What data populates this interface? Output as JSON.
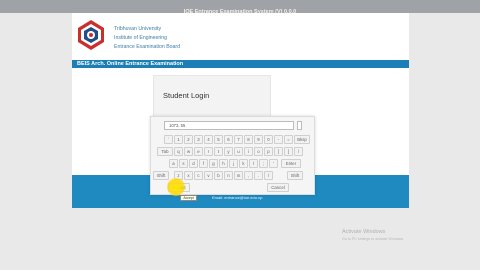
{
  "window": {
    "title": "IOE Entrance Examination System (V) 0.0.0"
  },
  "header": {
    "org_lines": [
      "Tribhuvan University",
      "Institute of Engineering",
      "Entrance Examination Board"
    ]
  },
  "section": {
    "title": "BEIS Arch. Online Entrance Examination"
  },
  "login": {
    "title": "Student Login"
  },
  "keyboard": {
    "input_value": "1073, 55",
    "rows": [
      [
        "`",
        "1",
        "2",
        "3",
        "4",
        "5",
        "6",
        "7",
        "8",
        "9",
        "0",
        "-",
        "=",
        "Bksp"
      ],
      [
        "Tab",
        "q",
        "w",
        "e",
        "r",
        "t",
        "y",
        "u",
        "i",
        "o",
        "p",
        "[",
        "]",
        "\\"
      ],
      [
        "a",
        "s",
        "d",
        "f",
        "g",
        "h",
        "j",
        "k",
        "l",
        ";",
        "'",
        "Enter"
      ],
      [
        "Shift",
        "z",
        "x",
        "c",
        "v",
        "b",
        "n",
        "m",
        ",",
        ".",
        "/",
        "Shift"
      ]
    ],
    "accept_label": "Accept",
    "cancel_label": "Cancel",
    "tooltip": "Accept"
  },
  "footer": {
    "email": "Email: entrance@ioe.edu.np"
  },
  "watermark": {
    "line1": "Activate Windows",
    "line2": "Go to PC settings to activate Windows."
  },
  "colors": {
    "accent": "#1b7fb5",
    "footer": "#1e8ac0",
    "org_text": "#3d7ea8"
  }
}
